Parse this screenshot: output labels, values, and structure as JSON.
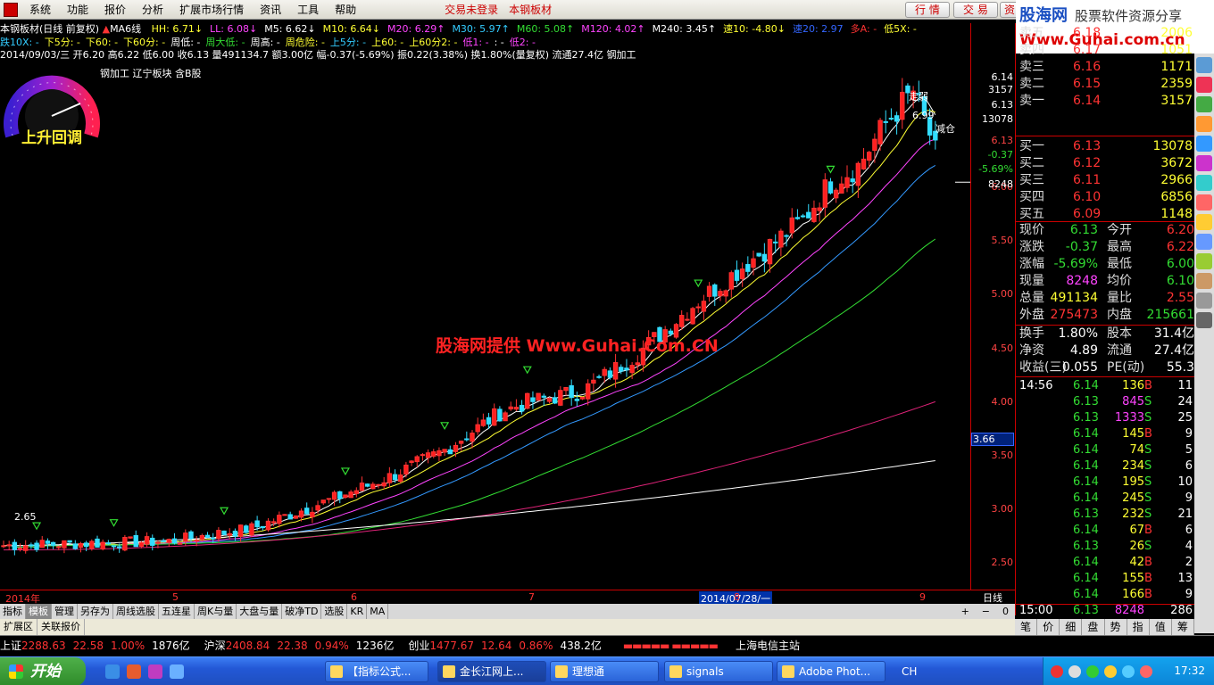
{
  "menu": {
    "items": [
      "系统",
      "功能",
      "报价",
      "分析",
      "扩展市场行情",
      "资讯",
      "工具",
      "帮助"
    ],
    "center1": "交易未登录",
    "center2": "本钢板材",
    "btn_quote": "行 情",
    "btn_trade": "交 易",
    "btn_extra": "资"
  },
  "brand": {
    "line1": "股海网",
    "line1b": "股票软件资源分享",
    "line2": "Www.Guhai.com.cn"
  },
  "header": {
    "title": "本钢板材(日线 前复权)",
    "ma_name": "MA6线",
    "ma_items": [
      {
        "k": "HH: ",
        "v": "6.71",
        "dir": "↓",
        "cls": "y"
      },
      {
        "k": "LL: ",
        "v": "6.08",
        "dir": "↓",
        "cls": "m"
      },
      {
        "k": "M5: ",
        "v": "6.62",
        "dir": "↓",
        "cls": "w"
      },
      {
        "k": "M10: ",
        "v": "6.64",
        "dir": "↓",
        "cls": "y"
      },
      {
        "k": "M20: ",
        "v": "6.29",
        "dir": "↑",
        "cls": "m"
      },
      {
        "k": "M30: ",
        "v": "5.97",
        "dir": "↑",
        "cls": "c"
      },
      {
        "k": "M60: ",
        "v": "5.08",
        "dir": "↑",
        "cls": "g"
      },
      {
        "k": "M120: ",
        "v": "4.02",
        "dir": "↑",
        "cls": "m"
      },
      {
        "k": "M240: ",
        "v": "3.45",
        "dir": "↑",
        "cls": "w"
      },
      {
        "k": "速10: ",
        "v": "-4.80",
        "dir": "↓",
        "cls": "y"
      },
      {
        "k": "速20: ",
        "v": "2.97",
        "dir": "",
        "cls": "bl"
      },
      {
        "k": "多A: ",
        "v": "-",
        "dir": "",
        "cls": "r"
      },
      {
        "k": "低5X: ",
        "v": "-",
        "dir": "",
        "cls": "y"
      }
    ],
    "line2": [
      {
        "t": "跌10X: -",
        "cls": "c"
      },
      {
        "t": "下5分: -",
        "cls": "y"
      },
      {
        "t": "下60: -",
        "cls": "y"
      },
      {
        "t": "下60分: -",
        "cls": "y"
      },
      {
        "t": "周低: -",
        "cls": "w"
      },
      {
        "t": "周大低: -",
        "cls": "g"
      },
      {
        "t": "周高: -",
        "cls": "w"
      },
      {
        "t": "周危险: -",
        "cls": "y"
      },
      {
        "t": "上5分: -",
        "cls": "c"
      },
      {
        "t": "上60: -",
        "cls": "y"
      },
      {
        "t": "上60分2: -",
        "cls": "y"
      },
      {
        "t": "低1: -",
        "cls": "m"
      },
      {
        "t": ": -",
        "cls": "w"
      },
      {
        "t": "低2: -",
        "cls": "m"
      }
    ],
    "line3": "2014/09/03/三 开6.20 高6.22 低6.00 收6.13 量491134.7 额3.00亿 幅-0.37(-5.69%) 振0.22(3.38%) 换1.80%(量复权) 流通27.4亿 钢加工",
    "sector": "钢加工 辽宁板块 含B股"
  },
  "gauge": {
    "label": "上升回调"
  },
  "chart_data": {
    "type": "candlestick",
    "title": "本钢板材(日线 前复权)",
    "annotations": [
      "走弱",
      "减仓",
      "6.99",
      "2.65"
    ],
    "watermark": "股海网提供 Www.Guhai.Com.CN",
    "y_ticks": [
      "6.00",
      "5.50",
      "5.00",
      "4.50",
      "4.00",
      "3.50",
      "3.00",
      "2.50"
    ],
    "ylim": [
      2.25,
      7.2
    ],
    "x_labels": [
      "2014年",
      "5",
      "6",
      "7",
      "2014/07/28/一",
      "8",
      "9"
    ],
    "current_price": "3.66",
    "ma_end_values": {
      "M5": 6.62,
      "M10": 6.64,
      "M20": 6.29,
      "M30": 5.97,
      "M60": 5.08,
      "M120": 4.02,
      "M240": 3.45
    }
  },
  "axis_marks": [
    "6.14",
    "3157",
    "6.13",
    "13078",
    "6.13",
    "-0.37",
    "-5.69%",
    "8248"
  ],
  "orderbook": {
    "sells": [
      {
        "label": "卖五",
        "price": "6.18",
        "vol": "2006"
      },
      {
        "label": "卖四",
        "price": "6.17",
        "vol": "1051"
      },
      {
        "label": "卖三",
        "price": "6.16",
        "vol": "1171"
      },
      {
        "label": "卖二",
        "price": "6.15",
        "vol": "2359"
      },
      {
        "label": "卖一",
        "price": "6.14",
        "vol": "3157"
      }
    ],
    "buys": [
      {
        "label": "买一",
        "price": "6.13",
        "vol": "13078"
      },
      {
        "label": "买二",
        "price": "6.12",
        "vol": "3672"
      },
      {
        "label": "买三",
        "price": "6.11",
        "vol": "2966"
      },
      {
        "label": "买四",
        "price": "6.10",
        "vol": "6856"
      },
      {
        "label": "买五",
        "price": "6.09",
        "vol": "1148"
      }
    ]
  },
  "stats": [
    {
      "l1": "现价",
      "v1": "6.13",
      "c1": "g",
      "l2": "今开",
      "v2": "6.20",
      "c2": "r"
    },
    {
      "l1": "涨跌",
      "v1": "-0.37",
      "c1": "g",
      "l2": "最高",
      "v2": "6.22",
      "c2": "r"
    },
    {
      "l1": "涨幅",
      "v1": "-5.69%",
      "c1": "g",
      "l2": "最低",
      "v2": "6.00",
      "c2": "g"
    },
    {
      "l1": "现量",
      "v1": "8248",
      "c1": "m",
      "l2": "均价",
      "v2": "6.10",
      "c2": "g"
    },
    {
      "l1": "总量",
      "v1": "491134",
      "c1": "y",
      "l2": "量比",
      "v2": "2.55",
      "c2": "r"
    },
    {
      "l1": "外盘",
      "v1": "275473",
      "c1": "r",
      "l2": "内盘",
      "v2": "215661",
      "c2": "g"
    },
    {
      "l1": "换手",
      "v1": "1.80%",
      "c1": "w",
      "l2": "股本",
      "v2": "31.4亿",
      "c2": "w"
    },
    {
      "l1": "净资",
      "v1": "4.89",
      "c1": "w",
      "l2": "流通",
      "v2": "27.4亿",
      "c2": "w"
    },
    {
      "l1": "收益(三)",
      "v1": "0.055",
      "c1": "w",
      "l2": "PE(动)",
      "v2": "55.3",
      "c2": "w"
    }
  ],
  "ticks": [
    {
      "time": "14:56",
      "price": "6.14",
      "vol": "136",
      "bs": "B",
      "n": "11",
      "vc": "y"
    },
    {
      "time": "",
      "price": "6.13",
      "vol": "845",
      "bs": "S",
      "n": "24",
      "vc": "m"
    },
    {
      "time": "",
      "price": "6.13",
      "vol": "1333",
      "bs": "S",
      "n": "25",
      "vc": "m"
    },
    {
      "time": "",
      "price": "6.14",
      "vol": "145",
      "bs": "B",
      "n": "9",
      "vc": "y"
    },
    {
      "time": "",
      "price": "6.14",
      "vol": "74",
      "bs": "S",
      "n": "5",
      "vc": "y"
    },
    {
      "time": "",
      "price": "6.14",
      "vol": "234",
      "bs": "S",
      "n": "6",
      "vc": "y"
    },
    {
      "time": "",
      "price": "6.14",
      "vol": "195",
      "bs": "S",
      "n": "10",
      "vc": "y"
    },
    {
      "time": "",
      "price": "6.14",
      "vol": "245",
      "bs": "S",
      "n": "9",
      "vc": "y"
    },
    {
      "time": "",
      "price": "6.13",
      "vol": "232",
      "bs": "S",
      "n": "21",
      "vc": "y"
    },
    {
      "time": "",
      "price": "6.14",
      "vol": "67",
      "bs": "B",
      "n": "6",
      "vc": "y"
    },
    {
      "time": "",
      "price": "6.13",
      "vol": "26",
      "bs": "S",
      "n": "4",
      "vc": "y"
    },
    {
      "time": "",
      "price": "6.14",
      "vol": "42",
      "bs": "B",
      "n": "2",
      "vc": "y"
    },
    {
      "time": "",
      "price": "6.14",
      "vol": "155",
      "bs": "B",
      "n": "13",
      "vc": "y"
    },
    {
      "time": "",
      "price": "6.14",
      "vol": "166",
      "bs": "B",
      "n": "9",
      "vc": "y"
    },
    {
      "time": "15:00",
      "price": "6.13",
      "vol": "8248",
      "bs": "",
      "n": "286",
      "vc": "m"
    }
  ],
  "rb_tabs": [
    "笔",
    "价",
    "细",
    "盘",
    "势",
    "指",
    "值",
    "筹"
  ],
  "dayline": "日线",
  "tabs": [
    "指标",
    "模板",
    "管理",
    "另存为",
    "周线选股",
    "五连星",
    "周K与量",
    "大盘与量",
    "破净TD",
    "选股",
    "KR",
    "MA"
  ],
  "tabs_nav": [
    "+",
    "−",
    "0"
  ],
  "tabs2": [
    "扩展区",
    "关联报价"
  ],
  "ticker": [
    {
      "label": "上证",
      "val": "2288.63",
      "chg": "22.58",
      "pct": "1.00%",
      "amt": "1876亿"
    },
    {
      "label": "沪深",
      "val": "2408.84",
      "chg": "22.38",
      "pct": "0.94%",
      "amt": "1236亿"
    },
    {
      "label": "创业",
      "val": "1477.67",
      "chg": "12.64",
      "pct": "0.86%",
      "amt": "438.2亿"
    }
  ],
  "ticker_tel": "上海电信主站",
  "taskbar": {
    "start": "开始",
    "tasks": [
      "【指标公式...",
      "金长江网上...",
      "理想通",
      "signals",
      "Adobe Phot..."
    ],
    "ime": "CH",
    "clock": "17:32"
  }
}
